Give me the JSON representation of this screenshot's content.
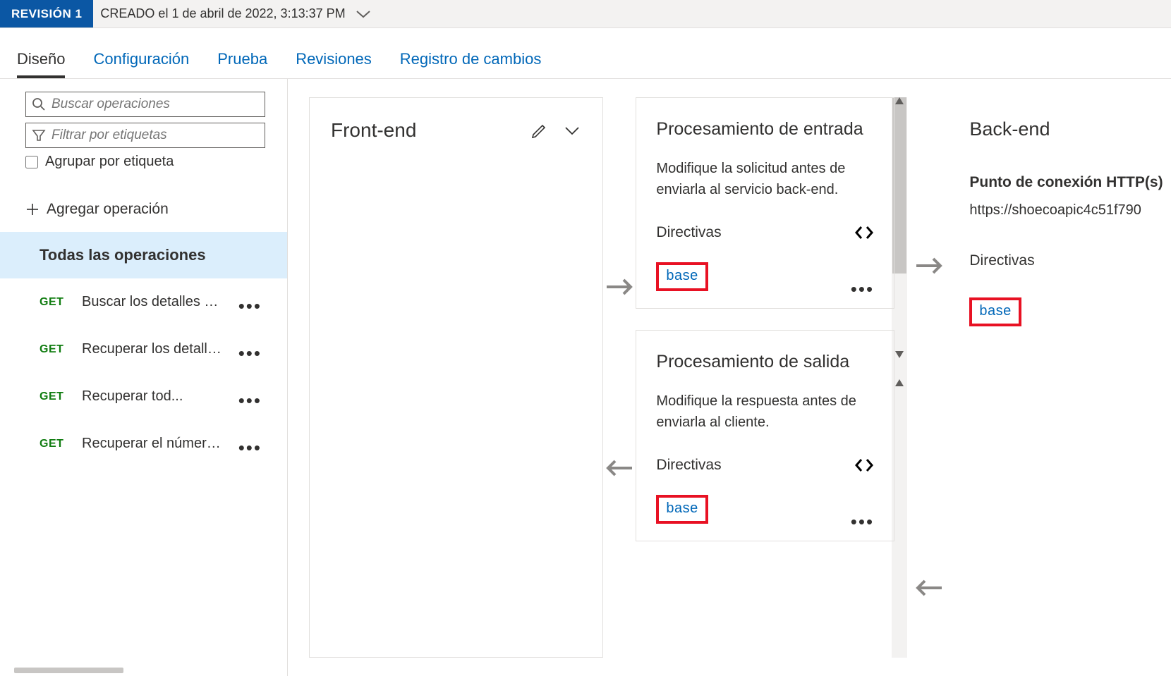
{
  "topbar": {
    "revision_label": "REVISIÓN 1",
    "created_text": "CREADO el 1 de abril de 2022, 3:13:37 PM"
  },
  "tabs": {
    "design": "Diseño",
    "config": "Configuración",
    "test": "Prueba",
    "revisions": "Revisiones",
    "changelog": "Registro de cambios"
  },
  "sidebar": {
    "search_placeholder": "Buscar operaciones",
    "filter_placeholder": "Filtrar por etiquetas",
    "group_label": "Agrupar por etiqueta",
    "add_operation": "Agregar operación",
    "all_operations": "Todas las operaciones",
    "ops": [
      {
        "method": "GET",
        "label": "Buscar los detalles de..."
      },
      {
        "method": "GET",
        "label": "Recuperar los detalles..."
      },
      {
        "method": "GET",
        "label": "Recuperar tod..."
      },
      {
        "method": "GET",
        "label": "Recuperar el número..."
      }
    ]
  },
  "frontend": {
    "title": "Front-end"
  },
  "inbound": {
    "title": "Procesamiento de entrada",
    "desc": "Modifique la solicitud antes de enviarla al servicio back-end.",
    "directives_label": "Directivas",
    "base": "base"
  },
  "outbound": {
    "title": "Procesamiento de salida",
    "desc": "Modifique la respuesta antes de enviarla al cliente.",
    "directives_label": "Directivas",
    "base": "base"
  },
  "backend": {
    "title": "Back-end",
    "endpoint_label": "Punto de conexión HTTP(s)",
    "endpoint_url": "https://shoecoapic4c51f790",
    "directives_label": "Directivas",
    "base": "base"
  }
}
